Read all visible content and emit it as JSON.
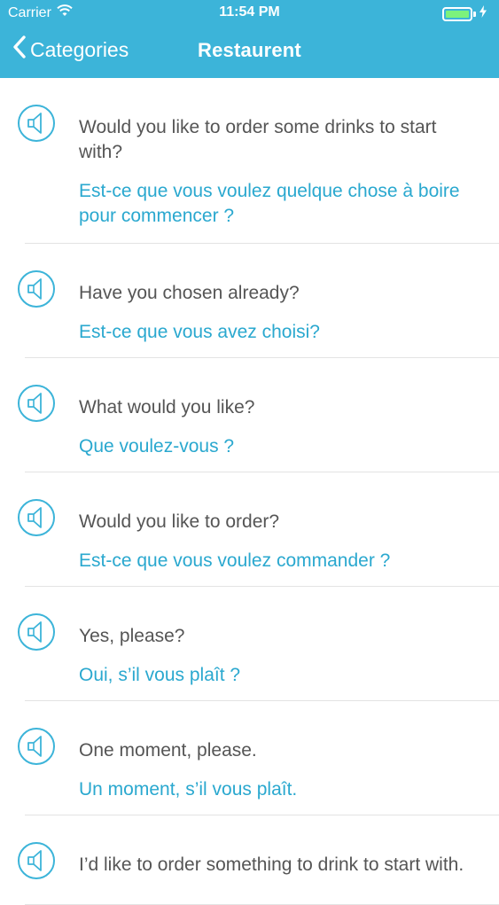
{
  "status_bar": {
    "carrier": "Carrier",
    "time": "11:54 PM",
    "battery_level": 1.0
  },
  "nav": {
    "back_label": "Categories",
    "title": "Restaurent"
  },
  "colors": {
    "accent": "#3cb4d9",
    "french_text": "#2aa8cf",
    "english_text": "#555555"
  },
  "phrases": [
    {
      "en": "Would you like to order some drinks to start with?",
      "fr": "Est-ce que vous voulez quelque chose à boire pour commencer ?"
    },
    {
      "en": "Have you chosen already?",
      "fr": "Est-ce que vous avez choisi?"
    },
    {
      "en": "What would you like?",
      "fr": "Que voulez-vous ?"
    },
    {
      "en": "Would you like to order?",
      "fr": "Est-ce que vous voulez commander ?"
    },
    {
      "en": "Yes, please?",
      "fr": "Oui, s’il vous plaît ?"
    },
    {
      "en": "One moment, please.",
      "fr": "Un moment, s’il vous plaît."
    },
    {
      "en": "I’d like to order something to drink to start with.",
      "fr": ""
    }
  ]
}
